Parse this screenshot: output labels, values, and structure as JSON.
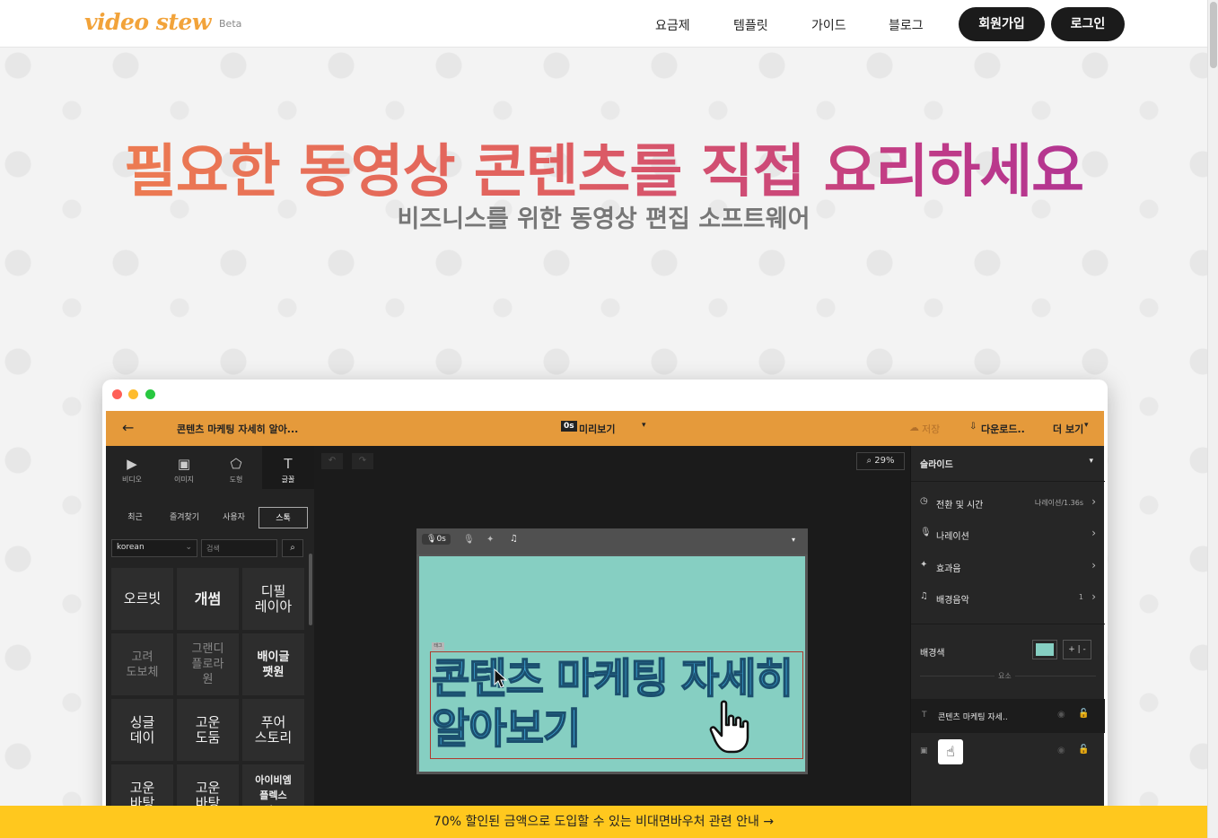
{
  "header": {
    "logo": "video stew",
    "beta": "Beta",
    "nav": [
      "요금제",
      "템플릿",
      "가이드",
      "블로그"
    ],
    "signup": "회원가입",
    "login": "로그인"
  },
  "hero": {
    "title": "필요한 동영상 콘텐츠를 직접 요리하세요",
    "subtitle": "비즈니스를 위한 동영상 편집 소프트웨어"
  },
  "app": {
    "back": "←",
    "doc_title": "콘텐츠 마케팅 자세히 알아...",
    "time_badge": "0s",
    "preview": "미리보기",
    "save": "저장",
    "download": "다운로드..",
    "more": "더 보기",
    "tools": [
      {
        "icon": "video-icon",
        "label": "비디오"
      },
      {
        "icon": "image-icon",
        "label": "이미지"
      },
      {
        "icon": "shape-icon",
        "label": "도형"
      },
      {
        "icon": "text-icon",
        "label": "글꼴"
      }
    ],
    "subtabs": [
      "최근",
      "즐겨찾기",
      "사용자",
      "스톡"
    ],
    "language": "korean",
    "search_placeholder": "검색",
    "fonts": [
      [
        "오르빗",
        "개썸",
        "디필\n레이아"
      ],
      [
        "고려\n도보체",
        "그랜디\n플로라\n원",
        "배이글\n팻원"
      ],
      [
        "싱글\n데이",
        "고운\n도둠",
        "푸어\n스토리"
      ],
      [
        "고운\n바탕",
        "고운\n바탕",
        "아이비엠\n플렉스\n산스"
      ]
    ],
    "zoom": "29%",
    "slide_time": "0s",
    "slide_tag": "태그",
    "slide_text_line1": "콘텐츠 마케팅 자세히",
    "slide_text_line2": "알아보기",
    "right": {
      "section": "슬라이드",
      "rows": [
        {
          "icon": "clock-icon",
          "label": "전환 및 시간",
          "value": "나레이션/1.36s"
        },
        {
          "icon": "mic-icon",
          "label": "나레이션",
          "value": ""
        },
        {
          "icon": "effect-icon",
          "label": "효과음",
          "value": ""
        },
        {
          "icon": "music-icon",
          "label": "배경음악",
          "value": "1"
        }
      ],
      "bg_label": "배경색",
      "bg_color": "#86cfc2",
      "elements_label": "요소",
      "layers": [
        {
          "icon": "text-icon",
          "label": "콘텐츠 마케팅 자세.."
        },
        {
          "icon": "image-icon",
          "label": ""
        }
      ]
    }
  },
  "banner": "70% 할인된 금액으로 도입할 수 있는 비대면바우처 관련 안내 →",
  "colors": {
    "accent": "#e59a3b",
    "banner": "#ffc81e",
    "dark": "#1b1b1b"
  }
}
